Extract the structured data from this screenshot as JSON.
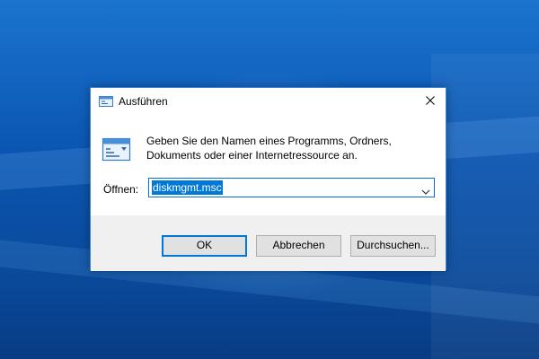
{
  "window": {
    "title": "Ausführen",
    "close_icon": "close-icon",
    "app_icon": "run-icon"
  },
  "content": {
    "description_line1": "Geben Sie den Namen eines Programms, Ordners,",
    "description_line2": "Dokuments oder einer Internetressource an.",
    "open_label": "Öffnen:",
    "open_value": "diskmgmt.msc"
  },
  "buttons": {
    "ok": "OK",
    "cancel": "Abbrechen",
    "browse": "Durchsuchen..."
  },
  "colors": {
    "accent": "#0078d7",
    "desktop": "#0b57b3",
    "footer": "#f0f0f0"
  }
}
